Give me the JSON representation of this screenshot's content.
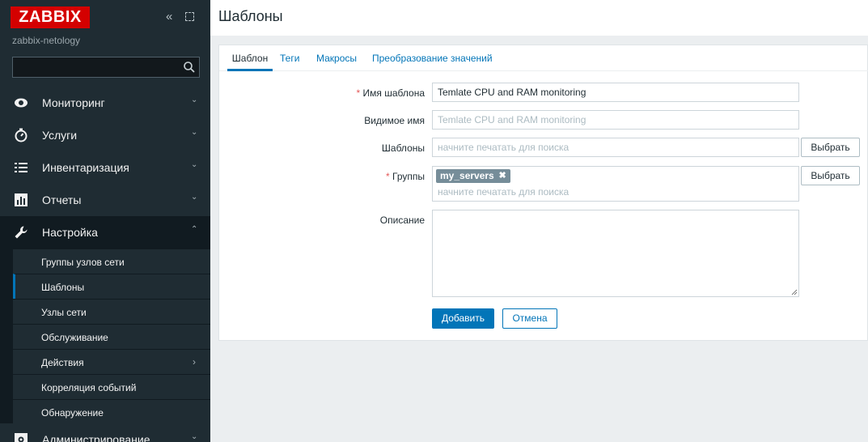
{
  "sidebar": {
    "logo": "ZABBIX",
    "server_name": "zabbix-netology",
    "collapse_glyph": "«",
    "search": {
      "value": "",
      "placeholder": ""
    },
    "menu": [
      {
        "label": "Мониторинг",
        "icon": "eye-icon",
        "arrow": "⌄"
      },
      {
        "label": "Услуги",
        "icon": "clock-icon",
        "arrow": "⌄"
      },
      {
        "label": "Инвентаризация",
        "icon": "list-icon",
        "arrow": "⌄"
      },
      {
        "label": "Отчеты",
        "icon": "bar-chart-icon",
        "arrow": "⌄"
      },
      {
        "label": "Настройка",
        "icon": "wrench-icon",
        "arrow": "⌃"
      },
      {
        "label": "Администрирование",
        "icon": "gear-icon",
        "arrow": "⌄"
      }
    ],
    "submenu": [
      {
        "label": "Группы узлов сети"
      },
      {
        "label": "Шаблоны"
      },
      {
        "label": "Узлы сети"
      },
      {
        "label": "Обслуживание"
      },
      {
        "label": "Действия",
        "arrow": "›"
      },
      {
        "label": "Корреляция событий"
      },
      {
        "label": "Обнаружение"
      }
    ]
  },
  "page": {
    "title": "Шаблоны"
  },
  "tabs": [
    "Шаблон",
    "Теги",
    "Макросы",
    "Преобразование значений"
  ],
  "form": {
    "name": {
      "required_mark": "*",
      "label": "Имя шаблона",
      "value": "Temlate CPU and RAM monitoring"
    },
    "visible_name": {
      "label": "Видимое имя",
      "placeholder": "Temlate CPU and RAM monitoring"
    },
    "templates": {
      "label": "Шаблоны",
      "placeholder": "начните печатать для поиска",
      "button": "Выбрать"
    },
    "groups": {
      "required_mark": "*",
      "label": "Группы",
      "chip": "my_servers",
      "chip_remove": "✖",
      "placeholder": "начните печатать для поиска",
      "button": "Выбрать"
    },
    "description": {
      "label": "Описание",
      "value": ""
    },
    "add_button": "Добавить",
    "cancel_button": "Отмена"
  },
  "colors": {
    "brand": "#d40000",
    "accent": "#0275b8",
    "sidebar_bg": "#1f2c33",
    "chip_bg": "#768d99",
    "required": "#e45959"
  }
}
